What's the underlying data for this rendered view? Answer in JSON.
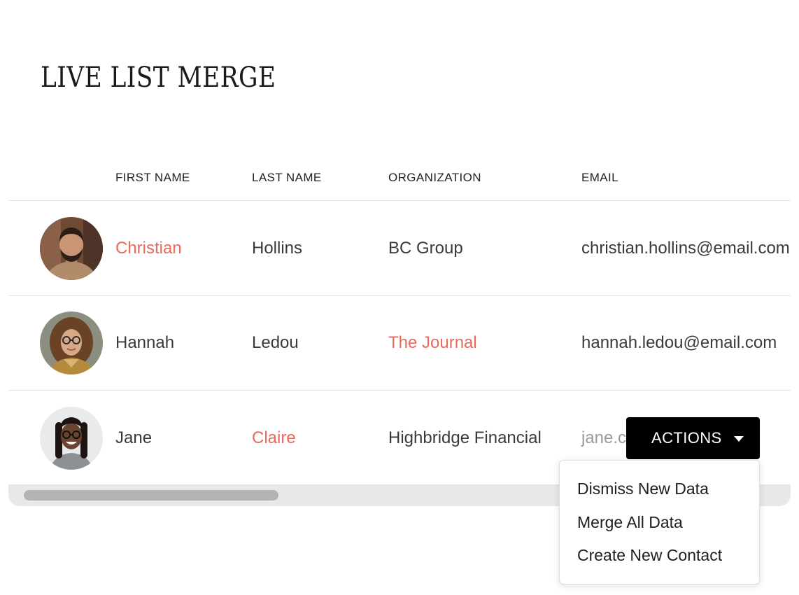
{
  "page": {
    "title": "LIVE LIST MERGE"
  },
  "table": {
    "columns": [
      "FIRST NAME",
      "LAST NAME",
      "ORGANIZATION",
      "EMAIL"
    ],
    "rows": [
      {
        "first_name": "Christian",
        "last_name": "Hollins",
        "organization": "BC Group",
        "email": "christian.hollins@email.com"
      },
      {
        "first_name": "Hannah",
        "last_name": "Ledou",
        "organization": "The Journal",
        "email": "hannah.ledou@email.com"
      },
      {
        "first_name": "Jane",
        "last_name": "Claire",
        "organization": "Highbridge Financial",
        "email": "jane.c"
      }
    ]
  },
  "actions": {
    "button_label": "ACTIONS",
    "menu_items": [
      "Dismiss New Data",
      "Merge All Data",
      "Create New Contact"
    ]
  },
  "colors": {
    "changed_value": "#e8695d",
    "button_bg": "#000000"
  },
  "icons": {
    "actions_caret": "caret-down-icon"
  }
}
